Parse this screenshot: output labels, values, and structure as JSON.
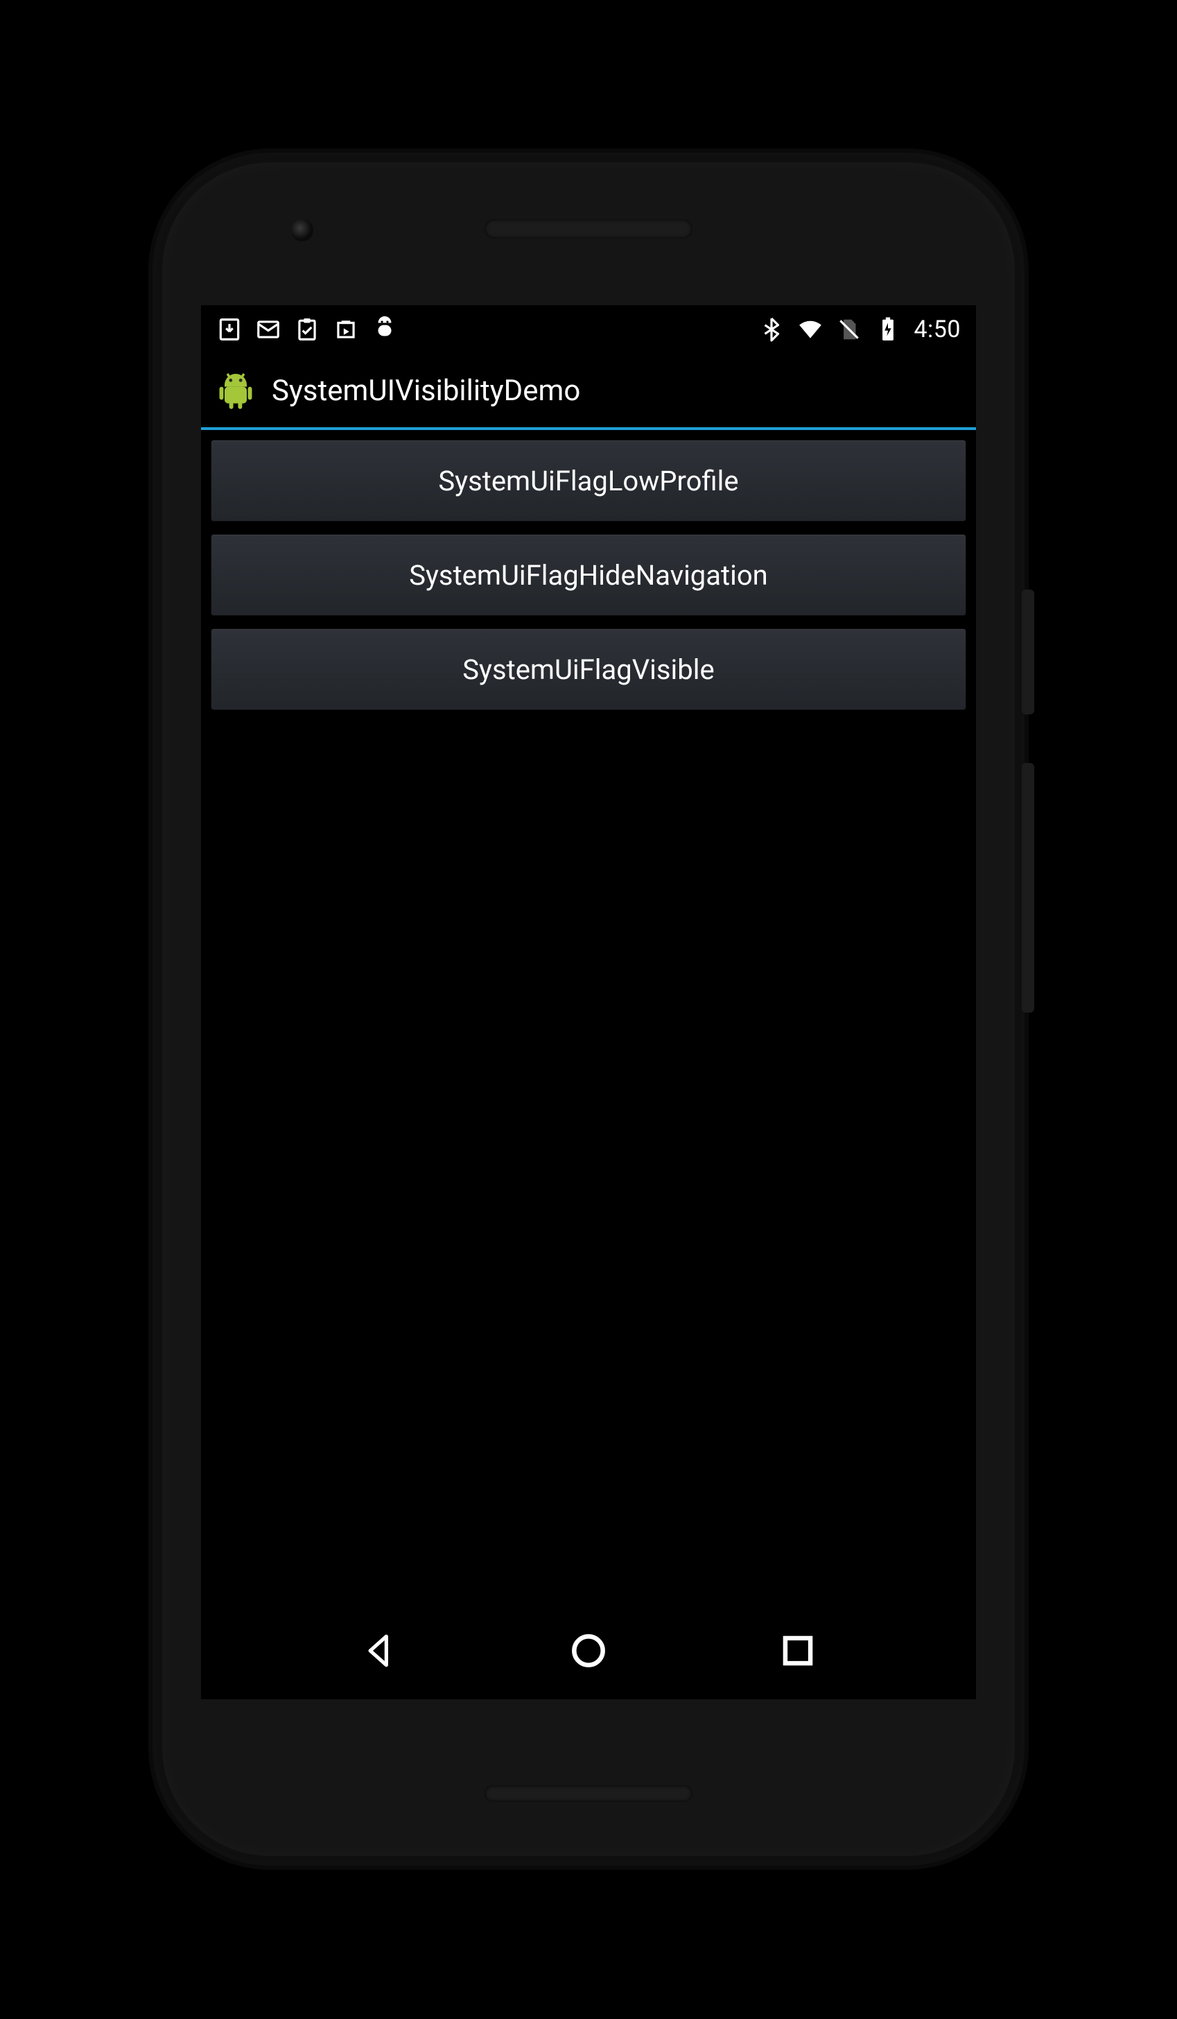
{
  "status_bar": {
    "clock": "4:50",
    "left_icons": [
      "download-icon",
      "mail-icon",
      "clipboard-check-icon",
      "play-store-icon",
      "android-debug-icon"
    ],
    "right_icons": [
      "bluetooth-icon",
      "wifi-icon",
      "no-sim-icon",
      "battery-charging-icon"
    ]
  },
  "action_bar": {
    "title": "SystemUIVisibilityDemo",
    "icon": "android-robot-icon"
  },
  "buttons": [
    {
      "label": "SystemUiFlagLowProfile"
    },
    {
      "label": "SystemUiFlagHideNavigation"
    },
    {
      "label": "SystemUiFlagVisible"
    }
  ],
  "nav_bar": {
    "items": [
      "back",
      "home",
      "recents"
    ]
  },
  "colors": {
    "accent": "#1fa0d8",
    "android_green": "#a4c639"
  }
}
